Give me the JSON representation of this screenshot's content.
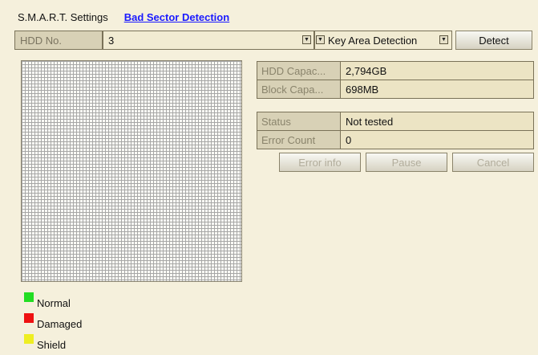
{
  "tabs": [
    {
      "label": "S.M.A.R.T. Settings"
    },
    {
      "label": "Bad Sector Detection"
    }
  ],
  "controls": {
    "hdd_label": "HDD No.",
    "hdd_value": "3",
    "mode_value": "Key Area Detection",
    "detect_label": "Detect"
  },
  "info": [
    {
      "key": "HDD Capac...",
      "value": "2,794GB"
    },
    {
      "key": "Block Capa...",
      "value": "698MB"
    },
    {
      "key": "Status",
      "value": "Not tested"
    },
    {
      "key": "Error Count",
      "value": "0"
    }
  ],
  "buttons": {
    "error_info": "Error info",
    "pause": "Pause",
    "cancel": "Cancel"
  },
  "legend": [
    {
      "label": "Normal",
      "color": "#22dd22"
    },
    {
      "label": "Damaged",
      "color": "#ee1111"
    },
    {
      "label": "Shield",
      "color": "#eeee22"
    }
  ]
}
